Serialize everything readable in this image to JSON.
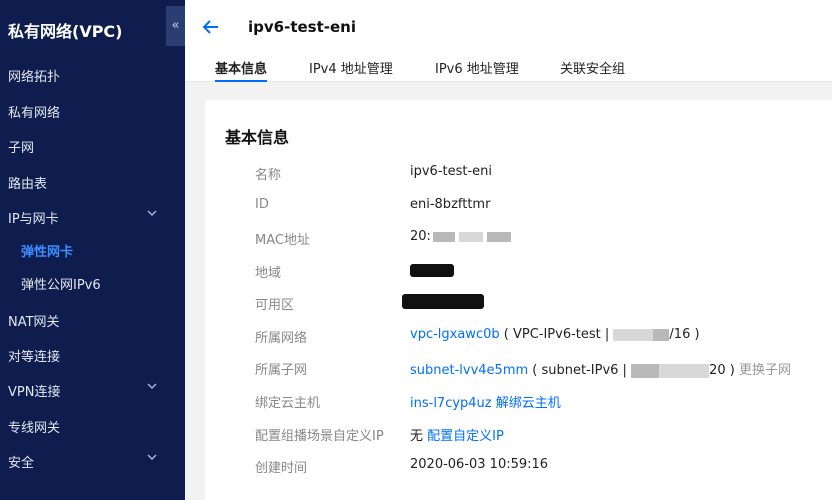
{
  "sidebar": {
    "title": "私有网络(VPC)",
    "collapse_icon": "«",
    "items": [
      {
        "label": "网络拓扑"
      },
      {
        "label": "私有网络"
      },
      {
        "label": "子网"
      },
      {
        "label": "路由表"
      },
      {
        "label": "IP与网卡"
      },
      {
        "label": "弹性网卡"
      },
      {
        "label": "弹性公网IPv6"
      },
      {
        "label": "NAT网关"
      },
      {
        "label": "对等连接"
      },
      {
        "label": "VPN连接"
      },
      {
        "label": "专线网关"
      },
      {
        "label": "安全"
      }
    ]
  },
  "header": {
    "title": "ipv6-test-eni",
    "tabs": [
      {
        "label": "基本信息"
      },
      {
        "label": "IPv4 地址管理"
      },
      {
        "label": "IPv6 地址管理"
      },
      {
        "label": "关联安全组"
      }
    ]
  },
  "basic": {
    "section_title": "基本信息",
    "fields": {
      "name": {
        "label": "名称",
        "value": "ipv6-test-eni"
      },
      "id": {
        "label": "ID",
        "value": "eni-8bzfttmr"
      },
      "mac": {
        "label": "MAC地址",
        "value_prefix": "20:"
      },
      "region": {
        "label": "地域"
      },
      "zone": {
        "label": "可用区"
      },
      "vpc": {
        "label": "所属网络",
        "link": "vpc-lgxawc0b",
        "paren_open": "( VPC-IPv6-test |",
        "suffix": "/16 )"
      },
      "subnet": {
        "label": "所属子网",
        "link": "subnet-lvv4e5mm",
        "paren_open": "( subnet-IPv6 |",
        "suffix": "20 )",
        "action": "更换子网"
      },
      "host": {
        "label": "绑定云主机",
        "link": "ins-l7cyp4uz",
        "action": "解绑云主机"
      },
      "multicast": {
        "label": "配置组播场景自定义IP",
        "value": "无",
        "action": "配置自定义IP"
      },
      "created": {
        "label": "创建时间",
        "value": "2020-06-03 10:59:16"
      }
    }
  },
  "colors": {
    "sidebar_bg": "#0e1d4d",
    "accent": "#006eff",
    "active_nav": "#3d8bff"
  }
}
